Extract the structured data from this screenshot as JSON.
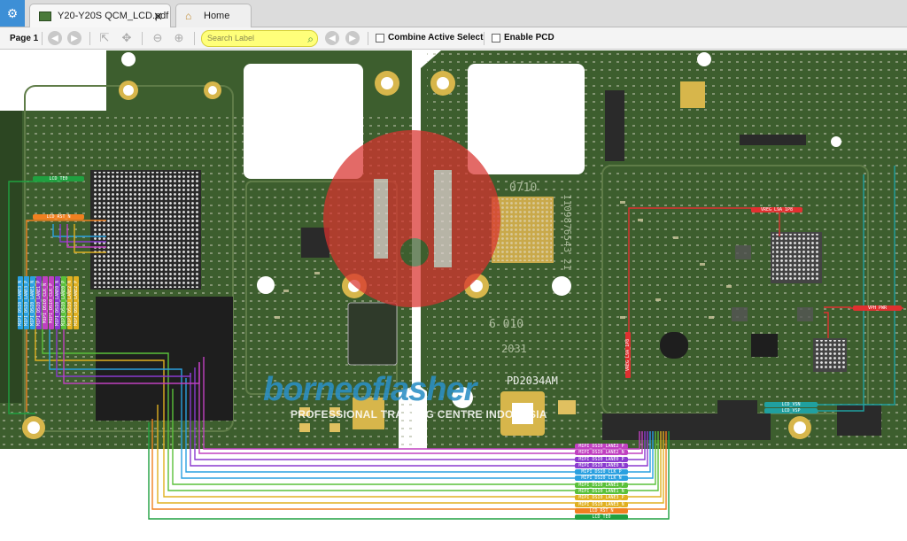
{
  "tabs": [
    {
      "label": "Y20-Y20S QCM_LCD.pdf",
      "active": true
    },
    {
      "label": "Home",
      "active": false
    }
  ],
  "toolbar": {
    "page_label": "Page 1",
    "search_placeholder": "Search Label",
    "combine_label": "Combine Active Select",
    "enable_pcd_label": "Enable PCD"
  },
  "watermark": {
    "title": "borneoflasher",
    "subtitle": "PROFESSIONAL TRAINING CENTRE INDONESIA"
  },
  "silkscreen": {
    "code_0710": "0710",
    "serial": "1109876543 21",
    "code_6010": "6 010",
    "code_2031": "2031",
    "board_id": "PD2034AM"
  },
  "net_labels_bottom": [
    {
      "text": "MIPI_DSI0_LANE2_P",
      "color": "#c040c0"
    },
    {
      "text": "MIPI_DSI0_LANE2_N",
      "color": "#c040c0"
    },
    {
      "text": "MIPI_DSI0_LANE0_P",
      "color": "#8a3acf"
    },
    {
      "text": "MIPI_DSI0_LANE0_N",
      "color": "#8a3acf"
    },
    {
      "text": "MIPI_DSI0_CLK_P",
      "color": "#2aa0e0"
    },
    {
      "text": "MIPI_DSI0_CLK_N",
      "color": "#2aa0e0"
    },
    {
      "text": "MIPI_DSI0_LANE1_P",
      "color": "#5ac03a"
    },
    {
      "text": "MIPI_DSI0_LANE1_N",
      "color": "#5ac03a"
    },
    {
      "text": "MIPI_DSI0_LANE3_P",
      "color": "#e0b020"
    },
    {
      "text": "MIPI_DSI0_LANE3_N",
      "color": "#e0b020"
    },
    {
      "text": "LCD_RST_N",
      "color": "#f08020"
    },
    {
      "text": "LCD_TE0",
      "color": "#20a040"
    }
  ],
  "net_labels_left": [
    {
      "text": "LCD_TE0",
      "color": "#20a040"
    },
    {
      "text": "LCD_RST_N",
      "color": "#f08020"
    }
  ],
  "vertical_labels": [
    {
      "text": "MIPI_DSI0_LANE3_N",
      "color": "#2aa0e0"
    },
    {
      "text": "MIPI_DSI0_LANE3_P",
      "color": "#2aa0e0"
    },
    {
      "text": "MIPI_DSI0_LANE1_N",
      "color": "#2aa0e0"
    },
    {
      "text": "MIPI_DSI0_LANE1_P",
      "color": "#8a3acf"
    },
    {
      "text": "MIPI_DSI0_CLK_N",
      "color": "#c040c0"
    },
    {
      "text": "MIPI_DSI0_CLK_P",
      "color": "#c040c0"
    },
    {
      "text": "MIPI_DSI0_LANE0_N",
      "color": "#8a3acf"
    },
    {
      "text": "MIPI_DSI0_LANE0_P",
      "color": "#5ac03a"
    },
    {
      "text": "MIPI_DSI0_LANE2_N",
      "color": "#e0b020"
    },
    {
      "text": "MIPI_DSI0_LANE2_P",
      "color": "#e0b020"
    }
  ],
  "right_labels": [
    {
      "text": "VREG_L9A_1P8",
      "color": "#e03030"
    },
    {
      "text": "VPH_PWR",
      "color": "#e03030"
    },
    {
      "text": "LCD_VSN",
      "color": "#20a0a0"
    },
    {
      "text": "LCD_VSP",
      "color": "#20a0a0"
    },
    {
      "text": "VREG_L9A_1P8",
      "color": "#e03030"
    }
  ],
  "colors": {
    "pcb_green": "#3d5e2e",
    "pcb_dark": "#2c4622",
    "pad_gold": "#d7b64b",
    "app_blue": "#3d8fd6"
  }
}
